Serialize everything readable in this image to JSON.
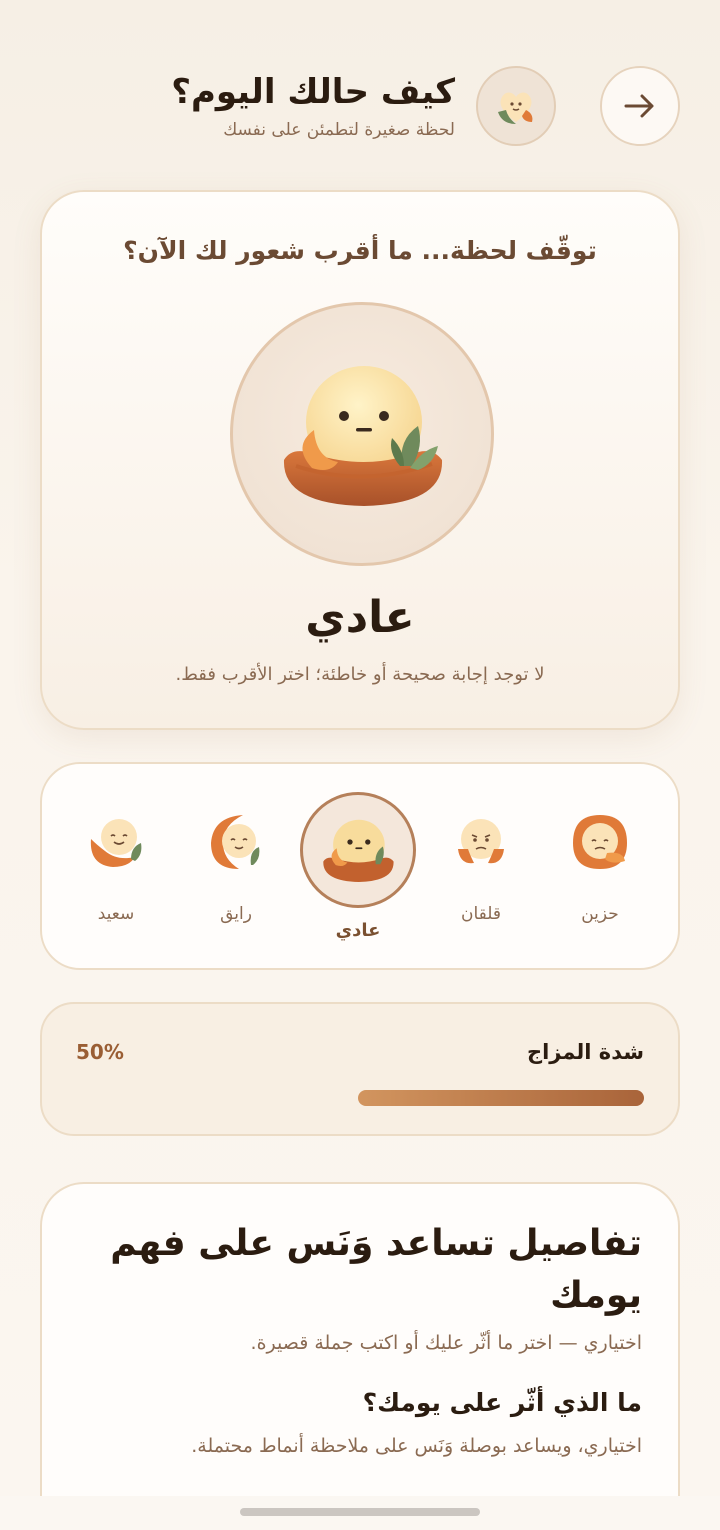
{
  "header": {
    "title": "كيف حالك اليوم؟",
    "subtitle": "لحظة صغيرة لتطمئن على نفسك",
    "back_icon": "arrow-right-icon",
    "avatar_icon": "heart-leaf-icon"
  },
  "mood_card": {
    "question": "توقّف لحظة... ما أقرب شعور لك الآن؟",
    "selected_mood": "عادي",
    "hint": "لا توجد إجابة صحيحة أو خاطئة؛ اختر الأقرب فقط."
  },
  "moods": [
    {
      "label": "حزين",
      "icon": "sad-mood-icon"
    },
    {
      "label": "قلقان",
      "icon": "anxious-mood-icon"
    },
    {
      "label": "عادي",
      "icon": "neutral-mood-icon",
      "selected": true
    },
    {
      "label": "رايق",
      "icon": "calm-mood-icon"
    },
    {
      "label": "سعيد",
      "icon": "happy-mood-icon"
    }
  ],
  "intensity": {
    "label": "شدة المزاج",
    "value_text": "50%",
    "value": 0.5
  },
  "details": {
    "title": "تفاصيل تساعد وَنَس على فهم يومك",
    "subtitle": "اختياري — اختر ما أثّر عليك أو اكتب جملة قصيرة.",
    "question": "ما الذي أثّر على يومك؟",
    "question_hint": "اختياري، ويساعد بوصلة وَنَس على ملاحظة أنماط محتملة."
  },
  "colors": {
    "accent": "#a9643a",
    "accent_light": "#d2955f",
    "text_primary": "#2b1c10",
    "text_secondary": "#8a6a52",
    "border": "#ecdcc6"
  }
}
